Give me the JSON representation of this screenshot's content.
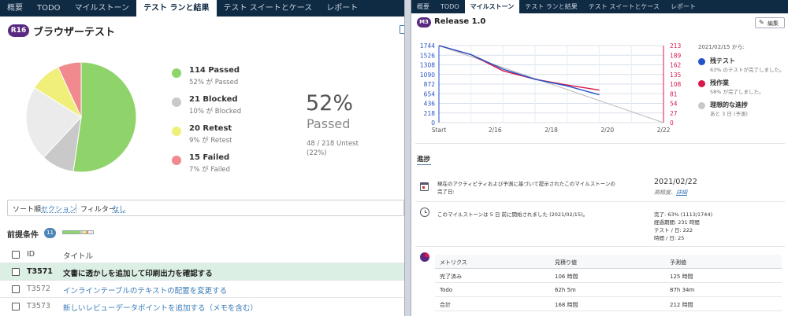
{
  "left": {
    "tabs": [
      "概要",
      "TODO",
      "マイルストーン",
      "テスト ランと結果",
      "テスト スイートとケース",
      "レポート"
    ],
    "active_tab": 3,
    "run_badge": "R16",
    "run_title": "ブラウザーテスト",
    "legend": [
      {
        "main": "114 Passed",
        "sub": "52% が Passed",
        "color": "#8fd46a"
      },
      {
        "main": "21 Blocked",
        "sub": "10% が Blocked",
        "color": "#c9c9c9"
      },
      {
        "main": "20 Retest",
        "sub": "9% が Retest",
        "color": "#efef7a"
      },
      {
        "main": "15 Failed",
        "sub": "7% が Failed",
        "color": "#f08a8e"
      }
    ],
    "pie": [
      {
        "name": "Passed",
        "value": 114,
        "color": "#8fd46a"
      },
      {
        "name": "Blocked",
        "value": 21,
        "color": "#c9c9c9"
      },
      {
        "name": "Untested",
        "value": 48,
        "color": "#ebebeb"
      },
      {
        "name": "Retest",
        "value": 20,
        "color": "#efef7a"
      },
      {
        "name": "Failed",
        "value": 15,
        "color": "#f08a8e"
      }
    ],
    "big_percent": "52%",
    "big_label": "Passed",
    "untest_line1": "48 / 218 Untest",
    "untest_line2": "(22%)",
    "sort_label": "ソート順:",
    "sort_value": "セクション",
    "filter_label": "フィルター:",
    "filter_value": "なし",
    "section_title": "前提条件",
    "section_count": "11",
    "col_id": "ID",
    "col_title": "タイトル",
    "rows": [
      {
        "id": "T3571",
        "title": "文書に透かしを追加して印刷出力を確認する",
        "highlight": true
      },
      {
        "id": "T3572",
        "title": "インラインテーブルのテキストの配置を変更する",
        "highlight": false
      },
      {
        "id": "T3573",
        "title": "新しいレビューデータポイントを追加する（メモを含む）",
        "highlight": false
      }
    ]
  },
  "right": {
    "tabs": [
      "概要",
      "TODO",
      "マイルストーン",
      "テスト ランと結果",
      "テスト スイートとケース",
      "レポート"
    ],
    "active_tab": 2,
    "ms_badge": "M3",
    "ms_title": "Release 1.0",
    "edit_label": "編集",
    "legend_date": "2021/02/15 から:",
    "legend": [
      {
        "main": "残テスト",
        "sub": "63% のテストが完了しました。",
        "color": "#2453c8"
      },
      {
        "main": "残作業",
        "sub": "58% が完了しました。",
        "color": "#d8184a"
      },
      {
        "main": "理想的な進捗",
        "sub": "あと 3 日 (予測)",
        "color": "#c8c8c8"
      }
    ],
    "progress_title": "進捗",
    "forecast_text_1": "現在のアクティビティおよび予測に基づいて提示されたこのマイルストーンの",
    "forecast_text_2": "完了日:",
    "forecast_date": "2021/02/22",
    "forecast_note": "高精度、",
    "forecast_link": "詳細",
    "started_text": "このマイルストーンは 5 日 前に開始されました (2021/02/15)。",
    "stats": [
      "完了: 63% (1113/1744)",
      "経過期間: 231 時間",
      "テスト / 日: 222",
      "時間 / 日: 25"
    ],
    "metrics_header": [
      "メトリクス",
      "見積り値",
      "予測値"
    ],
    "metrics": [
      [
        "完了済み",
        "106 時間",
        "125 時間"
      ],
      [
        "Todo",
        "62h 5m",
        "87h 34m"
      ],
      [
        "合計",
        "168 時間",
        "212 時間"
      ]
    ]
  },
  "chart_data": {
    "type": "line",
    "x_labels": [
      "Start",
      "2/16",
      "2/18",
      "2/20",
      "2/22"
    ],
    "x": [
      0,
      1,
      2,
      3,
      4,
      5,
      6,
      7
    ],
    "y_left_ticks": [
      1744,
      1526,
      1308,
      1090,
      872,
      654,
      436,
      218,
      0
    ],
    "y_right_ticks": [
      213,
      189,
      162,
      135,
      108,
      81,
      54,
      27,
      0
    ],
    "ylim_left": [
      0,
      1744
    ],
    "ylim_right": [
      0,
      213
    ],
    "series": [
      {
        "name": "残テスト",
        "axis": "left",
        "color": "#2453c8",
        "x": [
          0,
          1,
          2,
          3,
          4,
          5
        ],
        "values": [
          1744,
          1540,
          1210,
          980,
          830,
          631
        ]
      },
      {
        "name": "残作業",
        "axis": "right",
        "color": "#d8184a",
        "x": [
          0,
          1,
          2,
          3,
          4,
          5
        ],
        "values": [
          213,
          188,
          143,
          120,
          104,
          90
        ]
      },
      {
        "name": "理想的な進捗",
        "axis": "left",
        "color": "#b9b9b9",
        "x": [
          0,
          7
        ],
        "values": [
          1744,
          0
        ]
      }
    ],
    "grid": true
  }
}
